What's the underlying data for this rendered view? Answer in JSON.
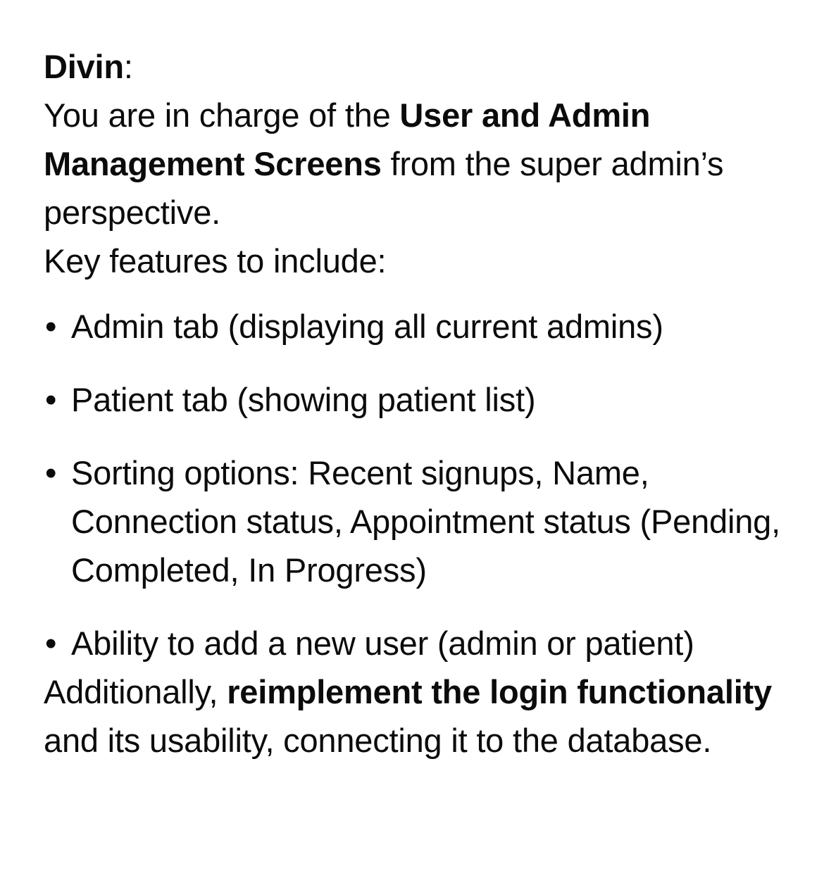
{
  "note": {
    "author": "Divin",
    "author_suffix": ":",
    "intro_pre": "You are in charge of the ",
    "intro_bold": "User and Admin Management Screens",
    "intro_post": " from the super admin’s perspective.",
    "features_heading": "Key features to include:",
    "bullet_glyph": "•",
    "features": [
      "Admin tab (displaying all current admins)",
      "Patient tab (showing patient list)",
      "Sorting options: Recent signups, Name, Connection status, Appointment status (Pending, Completed, In Progress)",
      "Ability to add a new user (admin or patient)"
    ],
    "closing_pre": "Additionally, ",
    "closing_bold": "reimplement the login functionality",
    "closing_post": " and its usability, connecting it to the database."
  }
}
